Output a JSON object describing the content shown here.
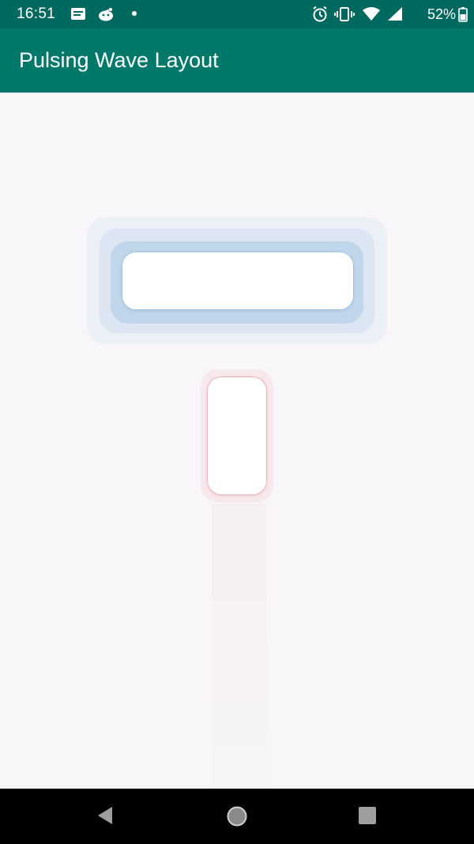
{
  "status_bar": {
    "time": "16:51",
    "battery": "52%",
    "left_icons": [
      "notification-list-icon",
      "reddit-icon",
      "dot-icon"
    ],
    "right_icons": [
      "alarm-icon",
      "vibrate-icon",
      "wifi-icon",
      "signal-icon",
      "battery-icon"
    ]
  },
  "app_bar": {
    "title": "Pulsing Wave Layout"
  },
  "colors": {
    "status_bar": "#00695f",
    "app_bar": "#00796b",
    "background": "#f8f6f9",
    "pulse_blue": "#9ec3e0",
    "pulse_red": "#eab3b8"
  },
  "nav_bar": {
    "icons": [
      "back-icon",
      "home-icon",
      "recents-icon"
    ]
  }
}
